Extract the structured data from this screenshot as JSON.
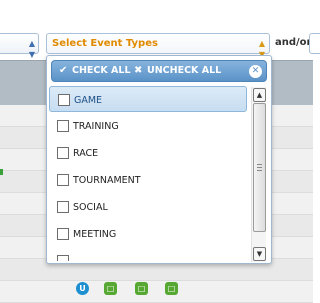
{
  "filter_bar": {
    "event_type_select": {
      "label": "Select Event Types"
    },
    "conjunction_label": "and/or T"
  },
  "dropdown": {
    "check_all_label": "CHECK ALL",
    "uncheck_all_label": "UNCHECK ALL",
    "items": [
      {
        "label": "GAME",
        "checked": false,
        "active": true
      },
      {
        "label": "TRAINING",
        "checked": false,
        "active": false
      },
      {
        "label": "RACE",
        "checked": false,
        "active": false
      },
      {
        "label": "TOURNAMENT",
        "checked": false,
        "active": false
      },
      {
        "label": "SOCIAL",
        "checked": false,
        "active": false
      },
      {
        "label": "MEETING",
        "checked": false,
        "active": false
      },
      {
        "label": "",
        "checked": false,
        "active": false
      }
    ]
  },
  "background_table": {
    "status_icons": [
      {
        "letter": "U",
        "color": "#1e8fd0",
        "shape": "round"
      },
      {
        "letter": "",
        "color": "#d23b3b",
        "shape": "square"
      },
      {
        "letter": "",
        "color": "#56a832",
        "shape": "square"
      },
      {
        "letter": "",
        "color": "#56a832",
        "shape": "square"
      }
    ]
  },
  "colors": {
    "select_label": "#e08a00",
    "dropdown_header": "#5b93c8",
    "active_item": "#c7ddf1"
  }
}
